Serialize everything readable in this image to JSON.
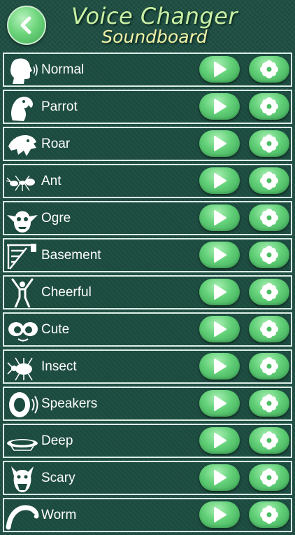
{
  "header": {
    "title": "Voice Changer",
    "subtitle": "Soundboard",
    "back_icon": "chevron-left-icon"
  },
  "colors": {
    "background": "#1f4f43",
    "button_green": "#62d078",
    "title": "#c9f0a4",
    "subtitle": "#f2f2a8"
  },
  "effects": [
    {
      "label": "Normal",
      "icon": "speaking-head-icon"
    },
    {
      "label": "Parrot",
      "icon": "parrot-icon"
    },
    {
      "label": "Roar",
      "icon": "panther-icon"
    },
    {
      "label": "Ant",
      "icon": "ant-icon"
    },
    {
      "label": "Ogre",
      "icon": "ogre-face-icon"
    },
    {
      "label": "Basement",
      "icon": "stairs-icon"
    },
    {
      "label": "Cheerful",
      "icon": "cheering-person-icon"
    },
    {
      "label": "Cute",
      "icon": "cute-eyes-icon"
    },
    {
      "label": "Insect",
      "icon": "beetle-icon"
    },
    {
      "label": "Speakers",
      "icon": "speaker-icon"
    },
    {
      "label": "Deep",
      "icon": "well-icon"
    },
    {
      "label": "Scary",
      "icon": "monster-icon"
    },
    {
      "label": "Worm",
      "icon": "worm-icon"
    }
  ],
  "row_buttons": {
    "play_icon": "play-icon",
    "effect_icon": "gear-icon"
  }
}
